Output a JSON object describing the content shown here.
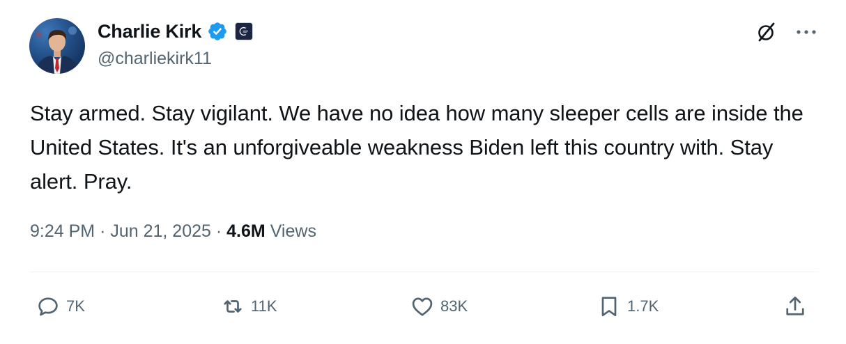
{
  "user": {
    "display_name": "Charlie Kirk",
    "handle": "@charliekirk11",
    "verified": true,
    "verified_color": "#1d9bf0"
  },
  "tweet": {
    "text": "Stay armed. Stay vigilant. We have no idea how many sleeper cells are inside the United States. It's an unforgiveable weakness Biden left this country with. Stay alert. Pray."
  },
  "meta": {
    "time": "9:24 PM",
    "date": "Jun 21, 2025",
    "views_count": "4.6M",
    "views_label": "Views"
  },
  "actions": {
    "replies": "7K",
    "reposts": "11K",
    "likes": "83K",
    "bookmarks": "1.7K"
  },
  "icons": [
    "grok-icon",
    "more-icon",
    "reply-icon",
    "repost-icon",
    "like-icon",
    "bookmark-icon",
    "share-icon"
  ],
  "colors": {
    "text_primary": "#0f1419",
    "text_secondary": "#536471",
    "divider": "#eff3f4"
  }
}
